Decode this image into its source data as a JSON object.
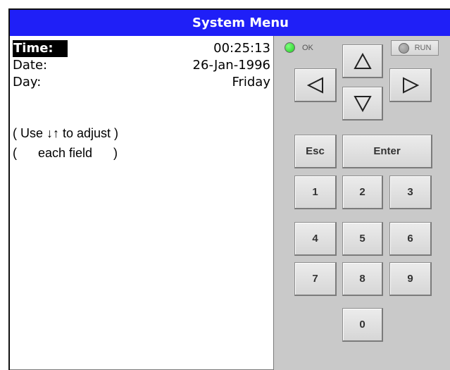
{
  "title": "System Menu",
  "screen": {
    "fields": [
      {
        "label": "Time:",
        "value": "00:25:13"
      },
      {
        "label": "Date:",
        "value": "26-Jan-1996"
      },
      {
        "label": "Day:",
        "value": "Friday"
      }
    ],
    "hint_line1": "( Use ↓↑ to adjust )",
    "hint_line2": "(      each field      )"
  },
  "indicators": {
    "ok_label": "OK",
    "ok_color": "#22cc22",
    "run_label": "RUN",
    "run_color": "#8a8a8a"
  },
  "keypad": {
    "up_icon": "up-triangle-icon",
    "down_icon": "down-triangle-icon",
    "left_icon": "left-triangle-icon",
    "right_icon": "right-triangle-icon",
    "esc": "Esc",
    "enter": "Enter",
    "digits": [
      "1",
      "2",
      "3",
      "4",
      "5",
      "6",
      "7",
      "8",
      "9",
      "0"
    ]
  },
  "colors": {
    "titlebar": "#1f1ff7",
    "panel": "#c9c9c9"
  }
}
